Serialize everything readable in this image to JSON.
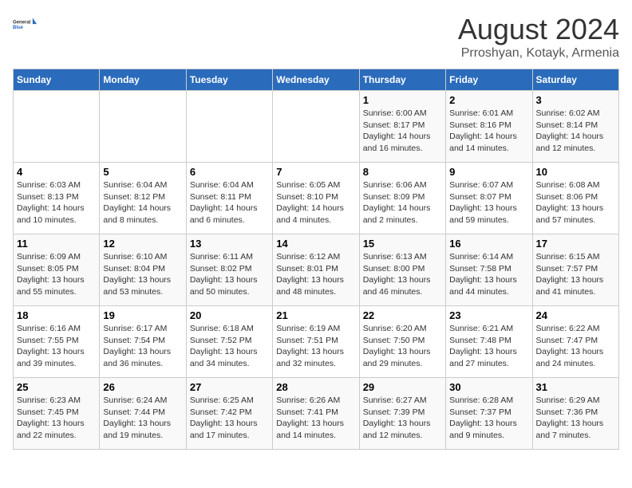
{
  "header": {
    "logo": {
      "general": "General",
      "blue": "Blue"
    },
    "title": "August 2024",
    "subtitle": "Prroshyan, Kotayk, Armenia"
  },
  "calendar": {
    "days_of_week": [
      "Sunday",
      "Monday",
      "Tuesday",
      "Wednesday",
      "Thursday",
      "Friday",
      "Saturday"
    ],
    "weeks": [
      [
        {
          "day": "",
          "info": ""
        },
        {
          "day": "",
          "info": ""
        },
        {
          "day": "",
          "info": ""
        },
        {
          "day": "",
          "info": ""
        },
        {
          "day": "1",
          "info": "Sunrise: 6:00 AM\nSunset: 8:17 PM\nDaylight: 14 hours\nand 16 minutes."
        },
        {
          "day": "2",
          "info": "Sunrise: 6:01 AM\nSunset: 8:16 PM\nDaylight: 14 hours\nand 14 minutes."
        },
        {
          "day": "3",
          "info": "Sunrise: 6:02 AM\nSunset: 8:14 PM\nDaylight: 14 hours\nand 12 minutes."
        }
      ],
      [
        {
          "day": "4",
          "info": "Sunrise: 6:03 AM\nSunset: 8:13 PM\nDaylight: 14 hours\nand 10 minutes."
        },
        {
          "day": "5",
          "info": "Sunrise: 6:04 AM\nSunset: 8:12 PM\nDaylight: 14 hours\nand 8 minutes."
        },
        {
          "day": "6",
          "info": "Sunrise: 6:04 AM\nSunset: 8:11 PM\nDaylight: 14 hours\nand 6 minutes."
        },
        {
          "day": "7",
          "info": "Sunrise: 6:05 AM\nSunset: 8:10 PM\nDaylight: 14 hours\nand 4 minutes."
        },
        {
          "day": "8",
          "info": "Sunrise: 6:06 AM\nSunset: 8:09 PM\nDaylight: 14 hours\nand 2 minutes."
        },
        {
          "day": "9",
          "info": "Sunrise: 6:07 AM\nSunset: 8:07 PM\nDaylight: 13 hours\nand 59 minutes."
        },
        {
          "day": "10",
          "info": "Sunrise: 6:08 AM\nSunset: 8:06 PM\nDaylight: 13 hours\nand 57 minutes."
        }
      ],
      [
        {
          "day": "11",
          "info": "Sunrise: 6:09 AM\nSunset: 8:05 PM\nDaylight: 13 hours\nand 55 minutes."
        },
        {
          "day": "12",
          "info": "Sunrise: 6:10 AM\nSunset: 8:04 PM\nDaylight: 13 hours\nand 53 minutes."
        },
        {
          "day": "13",
          "info": "Sunrise: 6:11 AM\nSunset: 8:02 PM\nDaylight: 13 hours\nand 50 minutes."
        },
        {
          "day": "14",
          "info": "Sunrise: 6:12 AM\nSunset: 8:01 PM\nDaylight: 13 hours\nand 48 minutes."
        },
        {
          "day": "15",
          "info": "Sunrise: 6:13 AM\nSunset: 8:00 PM\nDaylight: 13 hours\nand 46 minutes."
        },
        {
          "day": "16",
          "info": "Sunrise: 6:14 AM\nSunset: 7:58 PM\nDaylight: 13 hours\nand 44 minutes."
        },
        {
          "day": "17",
          "info": "Sunrise: 6:15 AM\nSunset: 7:57 PM\nDaylight: 13 hours\nand 41 minutes."
        }
      ],
      [
        {
          "day": "18",
          "info": "Sunrise: 6:16 AM\nSunset: 7:55 PM\nDaylight: 13 hours\nand 39 minutes."
        },
        {
          "day": "19",
          "info": "Sunrise: 6:17 AM\nSunset: 7:54 PM\nDaylight: 13 hours\nand 36 minutes."
        },
        {
          "day": "20",
          "info": "Sunrise: 6:18 AM\nSunset: 7:52 PM\nDaylight: 13 hours\nand 34 minutes."
        },
        {
          "day": "21",
          "info": "Sunrise: 6:19 AM\nSunset: 7:51 PM\nDaylight: 13 hours\nand 32 minutes."
        },
        {
          "day": "22",
          "info": "Sunrise: 6:20 AM\nSunset: 7:50 PM\nDaylight: 13 hours\nand 29 minutes."
        },
        {
          "day": "23",
          "info": "Sunrise: 6:21 AM\nSunset: 7:48 PM\nDaylight: 13 hours\nand 27 minutes."
        },
        {
          "day": "24",
          "info": "Sunrise: 6:22 AM\nSunset: 7:47 PM\nDaylight: 13 hours\nand 24 minutes."
        }
      ],
      [
        {
          "day": "25",
          "info": "Sunrise: 6:23 AM\nSunset: 7:45 PM\nDaylight: 13 hours\nand 22 minutes."
        },
        {
          "day": "26",
          "info": "Sunrise: 6:24 AM\nSunset: 7:44 PM\nDaylight: 13 hours\nand 19 minutes."
        },
        {
          "day": "27",
          "info": "Sunrise: 6:25 AM\nSunset: 7:42 PM\nDaylight: 13 hours\nand 17 minutes."
        },
        {
          "day": "28",
          "info": "Sunrise: 6:26 AM\nSunset: 7:41 PM\nDaylight: 13 hours\nand 14 minutes."
        },
        {
          "day": "29",
          "info": "Sunrise: 6:27 AM\nSunset: 7:39 PM\nDaylight: 13 hours\nand 12 minutes."
        },
        {
          "day": "30",
          "info": "Sunrise: 6:28 AM\nSunset: 7:37 PM\nDaylight: 13 hours\nand 9 minutes."
        },
        {
          "day": "31",
          "info": "Sunrise: 6:29 AM\nSunset: 7:36 PM\nDaylight: 13 hours\nand 7 minutes."
        }
      ]
    ]
  }
}
